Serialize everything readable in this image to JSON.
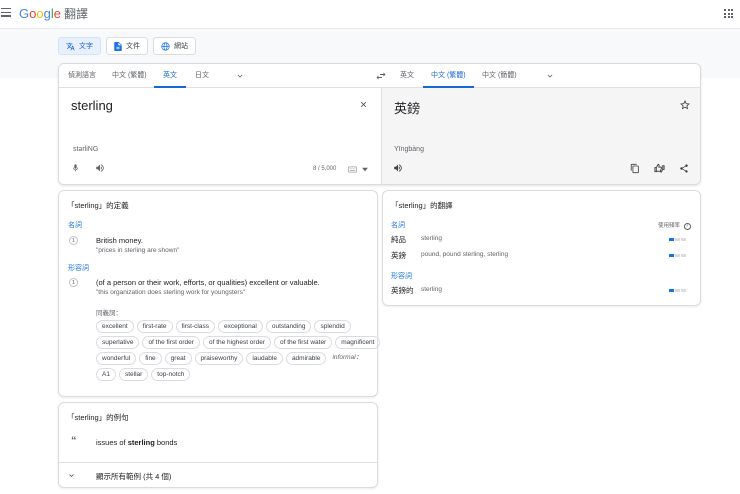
{
  "app": {
    "logo_letters": [
      {
        "ch": "G",
        "color": "#4285f4"
      },
      {
        "ch": "o",
        "color": "#ea4335"
      },
      {
        "ch": "o",
        "color": "#fbbc05"
      },
      {
        "ch": "g",
        "color": "#4285f4"
      },
      {
        "ch": "l",
        "color": "#34a853"
      },
      {
        "ch": "e",
        "color": "#ea4335"
      }
    ],
    "product": "翻譯",
    "menu_icon": "hamburger-menu-icon",
    "apps_icon": "apps-grid-icon"
  },
  "modes": [
    {
      "label": "文字",
      "icon": "translate-icon",
      "active": true
    },
    {
      "label": "文件",
      "icon": "document-icon",
      "active": false
    },
    {
      "label": "網站",
      "icon": "globe-icon",
      "active": false
    }
  ],
  "source_langs": [
    "偵測語言",
    "中文 (繁體)",
    "英文",
    "日文"
  ],
  "source_active": "英文",
  "target_langs": [
    "英文",
    "中文 (繁體)",
    "中文 (簡體)"
  ],
  "target_active": "中文 (繁體)",
  "source": {
    "text": "sterling",
    "transliteration": "stərliNG",
    "char_count": "8 / 5,000"
  },
  "target": {
    "text": "英鎊",
    "romanization": "Yīngbàng"
  },
  "definitions": {
    "title": "「sterling」的定義",
    "groups": [
      {
        "pos": "名詞",
        "entries": [
          {
            "num": "1",
            "def": "British money.",
            "example": "\"prices in sterling are shown\""
          }
        ]
      },
      {
        "pos": "形容詞",
        "entries": [
          {
            "num": "1",
            "def": "(of a person or their work, efforts, or qualities) excellent or valuable.",
            "example": "\"this organization does sterling work for youngsters\""
          }
        ]
      }
    ],
    "synonyms_label": "同義詞：",
    "synonyms": [
      "excellent",
      "first-rate",
      "first-class",
      "exceptional",
      "outstanding",
      "splendid",
      "superlative",
      "of the first order",
      "of the highest order",
      "of the first water",
      "magnificent",
      "wonderful",
      "fine",
      "great",
      "praiseworthy",
      "laudable",
      "admirable"
    ],
    "informal_label": "informal：",
    "informal_synonyms": [
      "A1",
      "stellar",
      "top-notch"
    ]
  },
  "translations": {
    "title": "「sterling」的翻譯",
    "frequency_label": "使用頻率",
    "groups": [
      {
        "pos": "名詞",
        "rows": [
          {
            "word": "純品",
            "meanings": "sterling",
            "frequency": 1
          },
          {
            "word": "英鎊",
            "meanings": "pound, pound sterling, sterling",
            "frequency": 1
          }
        ]
      },
      {
        "pos": "形容詞",
        "rows": [
          {
            "word": "英鎊的",
            "meanings": "sterling",
            "frequency": 1
          }
        ]
      }
    ]
  },
  "examples": {
    "title": "「sterling」的例句",
    "sentence_pre": "issues of ",
    "sentence_bold": "sterling",
    "sentence_post": " bonds",
    "show_all": "顯示所有範例 (共 4 個)"
  },
  "colors": {
    "accent": "#1a73e8",
    "active_tab": "#1967d2",
    "target_pane": "#f5f5f5"
  }
}
